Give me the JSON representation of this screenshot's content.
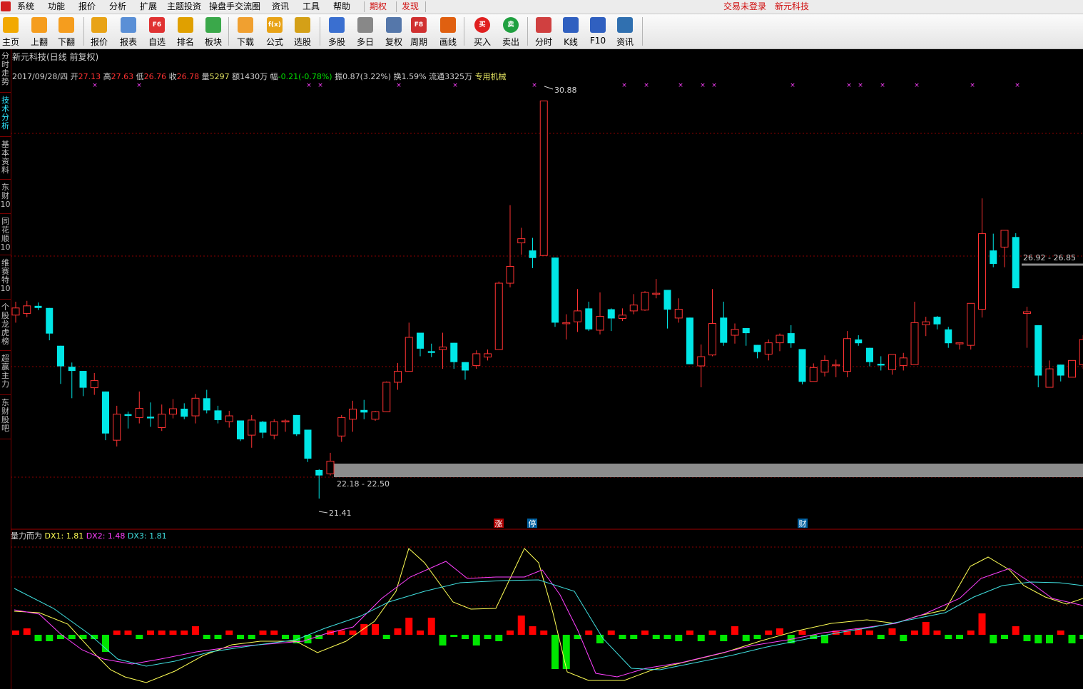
{
  "menu": {
    "items": [
      "系统",
      "功能",
      "报价",
      "分析",
      "扩展",
      "主题投资",
      "操盘手交流圈",
      "资讯",
      "工具",
      "帮助"
    ],
    "special": [
      "期权",
      "发现"
    ],
    "login_status": "交易未登录",
    "stock_name": "新元科技"
  },
  "toolbar": {
    "buttons": [
      {
        "label": "主页",
        "icon": "home-icon",
        "color": "#f2a900"
      },
      {
        "label": "上翻",
        "icon": "arrow-up-icon",
        "color": "#f59d1e"
      },
      {
        "label": "下翻",
        "icon": "arrow-down-icon",
        "color": "#f59d1e"
      },
      {
        "label": "报价",
        "icon": "price-icon",
        "color": "#e8a317"
      },
      {
        "label": "报表",
        "icon": "report-icon",
        "color": "#5a8fd6"
      },
      {
        "label": "自选",
        "icon": "f6-icon",
        "color": "#e03232"
      },
      {
        "label": "排名",
        "icon": "rank-icon",
        "color": "#e0a000"
      },
      {
        "label": "板块",
        "icon": "sector-icon",
        "color": "#3aa84a"
      },
      {
        "label": "下载",
        "icon": "download-icon",
        "color": "#f0a030"
      },
      {
        "label": "公式",
        "icon": "formula-icon",
        "color": "#e8a317"
      },
      {
        "label": "选股",
        "icon": "pick-stock-icon",
        "color": "#d4a017"
      },
      {
        "label": "多股",
        "icon": "multi-stock-icon",
        "color": "#3a6fd0"
      },
      {
        "label": "多日",
        "icon": "multi-day-icon",
        "color": "#888888"
      },
      {
        "label": "复权",
        "icon": "restore-right-icon",
        "color": "#5577aa"
      },
      {
        "label": "周期",
        "icon": "f8-icon",
        "color": "#d03030"
      },
      {
        "label": "画线",
        "icon": "draw-line-icon",
        "color": "#e06010"
      },
      {
        "label": "买入",
        "icon": "buy-icon",
        "color": "#e02020"
      },
      {
        "label": "卖出",
        "icon": "sell-icon",
        "color": "#20a040"
      },
      {
        "label": "分时",
        "icon": "intraday-icon",
        "color": "#d04040"
      },
      {
        "label": "K线",
        "icon": "kline-icon",
        "color": "#3060c0"
      },
      {
        "label": "F10",
        "icon": "f10-icon",
        "color": "#3060c0"
      },
      {
        "label": "资讯",
        "icon": "news-icon",
        "color": "#3070b0"
      }
    ],
    "icon_text": {
      "f6": "F6",
      "f8": "F8",
      "buy": "买",
      "sell": "卖",
      "formula": "f(x)"
    }
  },
  "sidebar": {
    "tabs": [
      {
        "label": "分时走势",
        "active": false
      },
      {
        "label": "技术分析",
        "active": true
      },
      {
        "label": "基本资料",
        "active": false
      },
      {
        "label": "东财10",
        "active": false
      },
      {
        "label": "同花顺10",
        "active": false
      },
      {
        "label": "维赛特10",
        "active": false
      },
      {
        "label": "个股龙虎榜",
        "active": false
      },
      {
        "label": "超赢主力",
        "active": false
      },
      {
        "label": "东财股吧",
        "active": false
      }
    ]
  },
  "chart_header": {
    "title": "新元科技(日线 前复权)",
    "date": "2017/09/28/四",
    "open_label": "开",
    "open": "27.13",
    "high_label": "高",
    "high": "27.63",
    "low_label": "低",
    "low": "26.76",
    "close_label": "收",
    "close": "26.78",
    "volume_label": "量",
    "volume": "5297",
    "amount_label": "额",
    "amount": "1430万",
    "change_label": "幅",
    "change": "-0.21(-0.78%)",
    "amplitude_label": "振",
    "amplitude": "0.87(3.22%)",
    "turnover_label": "换",
    "turnover": "1.59%",
    "float_label": "流通",
    "float": "3325万",
    "industry": "专用机械"
  },
  "colors": {
    "up": "#ff3232",
    "down": "#00e6e6",
    "grid": "#8b0000",
    "bar_up": "#ff0000",
    "bar_down": "#00e600",
    "dx1": "#ffff55",
    "dx2": "#ff40ff",
    "dx3": "#40e0e0",
    "marker": "#ff40ff",
    "gap_band": "#8c8c8c"
  },
  "annotations": {
    "max": "30.88",
    "min": "21.41",
    "gap_low": "22.18 - 22.50",
    "gap_high": "26.92 - 26.85",
    "event_up": "涨",
    "event_halt": "停",
    "event_fin": "财"
  },
  "indicator": {
    "name": "量力而为",
    "dx1_label": "DX1: 1.81",
    "dx2_label": "DX2: 1.48",
    "dx3_label": "DX3: 1.81"
  },
  "chart_data": {
    "type": "candlestick",
    "price_range": [
      20.9,
      31.4
    ],
    "candles": [
      {
        "o": 25.78,
        "c": 25.95,
        "h": 26.1,
        "l": 25.6
      },
      {
        "o": 25.82,
        "c": 26.0,
        "h": 26.12,
        "l": 25.73
      },
      {
        "o": 26.0,
        "c": 25.95,
        "h": 26.08,
        "l": 25.9
      },
      {
        "o": 25.95,
        "c": 25.34,
        "h": 25.95,
        "l": 25.18
      },
      {
        "o": 25.05,
        "c": 24.56,
        "h": 25.05,
        "l": 24.14
      },
      {
        "o": 24.55,
        "c": 24.45,
        "h": 24.65,
        "l": 23.8
      },
      {
        "o": 24.45,
        "c": 24.05,
        "h": 24.45,
        "l": 23.85
      },
      {
        "o": 24.05,
        "c": 24.22,
        "h": 24.4,
        "l": 23.88
      },
      {
        "o": 23.96,
        "c": 22.96,
        "h": 23.96,
        "l": 22.8
      },
      {
        "o": 22.8,
        "c": 23.42,
        "h": 23.62,
        "l": 22.65
      },
      {
        "o": 23.42,
        "c": 23.38,
        "h": 23.48,
        "l": 23.08
      },
      {
        "o": 23.34,
        "c": 23.56,
        "h": 23.96,
        "l": 23.2
      },
      {
        "o": 23.36,
        "c": 23.32,
        "h": 23.7,
        "l": 23.12
      },
      {
        "o": 23.1,
        "c": 23.42,
        "h": 23.65,
        "l": 23.02
      },
      {
        "o": 23.42,
        "c": 23.55,
        "h": 23.78,
        "l": 23.32
      },
      {
        "o": 23.55,
        "c": 23.36,
        "h": 23.68,
        "l": 23.3
      },
      {
        "o": 23.38,
        "c": 23.8,
        "h": 23.9,
        "l": 23.2
      },
      {
        "o": 23.8,
        "c": 23.51,
        "h": 24.0,
        "l": 23.44
      },
      {
        "o": 23.51,
        "c": 23.28,
        "h": 23.62,
        "l": 23.2
      },
      {
        "o": 23.24,
        "c": 23.38,
        "h": 23.5,
        "l": 23.1
      },
      {
        "o": 23.27,
        "c": 22.82,
        "h": 23.27,
        "l": 22.78
      },
      {
        "o": 22.92,
        "c": 23.28,
        "h": 23.4,
        "l": 22.62
      },
      {
        "o": 23.24,
        "c": 22.98,
        "h": 23.26,
        "l": 22.85
      },
      {
        "o": 22.92,
        "c": 23.24,
        "h": 23.3,
        "l": 22.82
      },
      {
        "o": 23.26,
        "c": 23.26,
        "h": 23.3,
        "l": 23.0
      },
      {
        "o": 23.4,
        "c": 22.94,
        "h": 23.4,
        "l": 22.9
      },
      {
        "o": 23.05,
        "c": 22.36,
        "h": 23.05,
        "l": 22.28
      },
      {
        "o": 22.09,
        "c": 21.96,
        "h": 22.11,
        "l": 21.41
      },
      {
        "o": 22.0,
        "c": 22.3,
        "h": 22.5,
        "l": 21.96
      },
      {
        "o": 22.9,
        "c": 23.34,
        "h": 23.4,
        "l": 22.76
      },
      {
        "o": 23.3,
        "c": 23.54,
        "h": 23.74,
        "l": 23.0
      },
      {
        "o": 23.52,
        "c": 23.46,
        "h": 23.76,
        "l": 23.3
      },
      {
        "o": 23.3,
        "c": 23.48,
        "h": 23.5,
        "l": 23.26
      },
      {
        "o": 23.48,
        "c": 24.18,
        "h": 24.2,
        "l": 23.48
      },
      {
        "o": 24.18,
        "c": 24.44,
        "h": 24.64,
        "l": 24.0
      },
      {
        "o": 24.44,
        "c": 25.25,
        "h": 25.6,
        "l": 24.44
      },
      {
        "o": 25.36,
        "c": 24.98,
        "h": 25.36,
        "l": 24.8
      },
      {
        "o": 24.92,
        "c": 24.88,
        "h": 25.1,
        "l": 24.78
      },
      {
        "o": 24.96,
        "c": 25.02,
        "h": 25.36,
        "l": 24.5
      },
      {
        "o": 25.12,
        "c": 24.66,
        "h": 25.12,
        "l": 24.5
      },
      {
        "o": 24.66,
        "c": 24.46,
        "h": 24.66,
        "l": 24.24
      },
      {
        "o": 24.58,
        "c": 24.86,
        "h": 24.94,
        "l": 24.5
      },
      {
        "o": 24.78,
        "c": 24.86,
        "h": 24.96,
        "l": 24.7
      },
      {
        "o": 24.96,
        "c": 26.54,
        "h": 26.58,
        "l": 24.96
      },
      {
        "o": 26.54,
        "c": 26.94,
        "h": 28.4,
        "l": 26.44
      },
      {
        "o": 27.5,
        "c": 27.6,
        "h": 27.86,
        "l": 27.22
      },
      {
        "o": 27.32,
        "c": 27.14,
        "h": 27.62,
        "l": 26.9
      },
      {
        "o": 27.2,
        "c": 30.88,
        "h": 30.88,
        "l": 27.2
      },
      {
        "o": 27.15,
        "c": 25.6,
        "h": 27.15,
        "l": 25.5
      },
      {
        "o": 25.58,
        "c": 25.6,
        "h": 25.8,
        "l": 25.2
      },
      {
        "o": 25.62,
        "c": 25.88,
        "h": 26.4,
        "l": 25.38
      },
      {
        "o": 25.94,
        "c": 25.44,
        "h": 26.1,
        "l": 25.4
      },
      {
        "o": 25.42,
        "c": 25.75,
        "h": 26.32,
        "l": 25.32
      },
      {
        "o": 25.92,
        "c": 25.7,
        "h": 25.94,
        "l": 25.4
      },
      {
        "o": 25.7,
        "c": 25.78,
        "h": 25.94,
        "l": 25.64
      },
      {
        "o": 25.88,
        "c": 26.02,
        "h": 26.28,
        "l": 25.8
      },
      {
        "o": 25.9,
        "c": 26.32,
        "h": 26.35,
        "l": 25.88
      },
      {
        "o": 26.3,
        "c": 26.3,
        "h": 26.64,
        "l": 26.18
      },
      {
        "o": 26.38,
        "c": 25.91,
        "h": 26.38,
        "l": 25.46
      },
      {
        "o": 25.71,
        "c": 25.92,
        "h": 26.18,
        "l": 25.6
      },
      {
        "o": 25.72,
        "c": 24.61,
        "h": 25.72,
        "l": 24.61
      },
      {
        "o": 24.57,
        "c": 24.79,
        "h": 25.08,
        "l": 24.06
      },
      {
        "o": 24.83,
        "c": 25.58,
        "h": 26.4,
        "l": 24.8
      },
      {
        "o": 25.72,
        "c": 25.12,
        "h": 26.1,
        "l": 25.05
      },
      {
        "o": 25.3,
        "c": 25.44,
        "h": 25.58,
        "l": 25.1
      },
      {
        "o": 25.47,
        "c": 25.35,
        "h": 25.47,
        "l": 25.05
      },
      {
        "o": 25.07,
        "c": 24.9,
        "h": 25.07,
        "l": 24.75
      },
      {
        "o": 24.85,
        "c": 25.12,
        "h": 25.2,
        "l": 24.7
      },
      {
        "o": 25.12,
        "c": 25.3,
        "h": 25.34,
        "l": 24.92
      },
      {
        "o": 25.35,
        "c": 25.11,
        "h": 25.54,
        "l": 25.0
      },
      {
        "o": 24.97,
        "c": 24.19,
        "h": 24.97,
        "l": 24.13
      },
      {
        "o": 24.2,
        "c": 24.53,
        "h": 24.63,
        "l": 24.2
      },
      {
        "o": 24.42,
        "c": 24.7,
        "h": 24.82,
        "l": 24.32
      },
      {
        "o": 24.6,
        "c": 24.6,
        "h": 24.72,
        "l": 24.3
      },
      {
        "o": 24.44,
        "c": 25.22,
        "h": 25.4,
        "l": 24.3
      },
      {
        "o": 25.2,
        "c": 25.11,
        "h": 25.3,
        "l": 25.05
      },
      {
        "o": 25.0,
        "c": 24.66,
        "h": 25.0,
        "l": 24.56
      },
      {
        "o": 24.62,
        "c": 24.58,
        "h": 24.8,
        "l": 24.46
      },
      {
        "o": 24.48,
        "c": 24.84,
        "h": 24.84,
        "l": 24.36
      },
      {
        "o": 24.58,
        "c": 24.76,
        "h": 24.88,
        "l": 24.46
      },
      {
        "o": 24.6,
        "c": 25.6,
        "h": 26.1,
        "l": 24.6
      },
      {
        "o": 25.55,
        "c": 25.62,
        "h": 25.74,
        "l": 25.28
      },
      {
        "o": 25.74,
        "c": 25.56,
        "h": 25.76,
        "l": 25.44
      },
      {
        "o": 25.44,
        "c": 25.11,
        "h": 25.5,
        "l": 25.0
      },
      {
        "o": 25.1,
        "c": 25.12,
        "h": 25.12,
        "l": 24.96
      },
      {
        "o": 25.06,
        "c": 26.06,
        "h": 26.06,
        "l": 24.96
      },
      {
        "o": 25.92,
        "c": 27.72,
        "h": 28.56,
        "l": 25.72
      },
      {
        "o": 27.32,
        "c": 27.0,
        "h": 27.72,
        "l": 26.92
      },
      {
        "o": 27.4,
        "c": 27.8,
        "h": 27.8,
        "l": 26.92
      },
      {
        "o": 27.64,
        "c": 26.42,
        "h": 27.73,
        "l": 26.42
      },
      {
        "o": 25.82,
        "c": 25.86,
        "h": 25.98,
        "l": 25.0
      },
      {
        "o": 25.54,
        "c": 24.34,
        "h": 25.54,
        "l": 24.06
      },
      {
        "o": 24.06,
        "c": 24.5,
        "h": 24.7,
        "l": 24.06
      },
      {
        "o": 24.6,
        "c": 24.34,
        "h": 24.6,
        "l": 24.2
      },
      {
        "o": 24.3,
        "c": 24.7,
        "h": 24.7,
        "l": 24.3
      },
      {
        "o": 24.6,
        "c": 25.2,
        "h": 25.3,
        "l": 24.5
      },
      {
        "o": 25.2,
        "c": 24.92,
        "h": 25.3,
        "l": 24.86
      }
    ]
  }
}
